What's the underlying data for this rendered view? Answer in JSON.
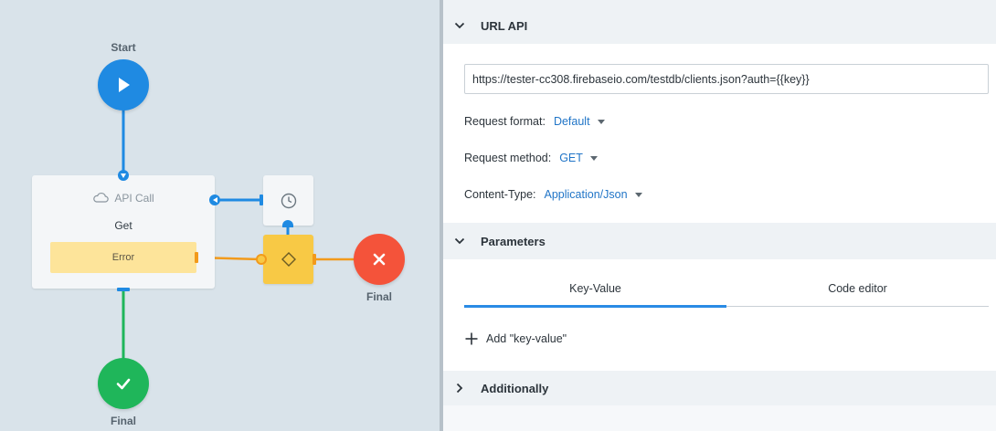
{
  "canvas": {
    "start_label": "Start",
    "final_fail_label": "Final",
    "final_success_label": "Final",
    "api_node": {
      "title": "API Call",
      "method": "Get",
      "error_label": "Error",
      "icon": "cloud-icon"
    },
    "timer_node": {
      "icon": "clock-icon"
    },
    "condition_node": {
      "icon": "diamond-icon"
    },
    "colors": {
      "start": "#1f8ae2",
      "fail": "#f4533a",
      "success": "#1fb65a",
      "link_blue": "#1f8ae2",
      "link_orange": "#f29a1b",
      "link_green": "#1fb65a",
      "condition": "#f8c945",
      "error_box": "#fde49a"
    }
  },
  "panel": {
    "url_section": {
      "title": "URL API",
      "url_value": "https://tester-cc308.firebaseio.com/testdb/clients.json?auth={{key}}",
      "request_format_label": "Request format:",
      "request_format_value": "Default",
      "request_method_label": "Request method:",
      "request_method_value": "GET",
      "content_type_label": "Content-Type:",
      "content_type_value": "Application/Json"
    },
    "parameters_section": {
      "title": "Parameters",
      "tabs": [
        {
          "label": "Key-Value",
          "active": true
        },
        {
          "label": "Code editor",
          "active": false
        }
      ],
      "add_label": "Add \"key-value\""
    },
    "additionally_section": {
      "title": "Additionally"
    },
    "colors": {
      "accent": "#2175c7",
      "tab_active": "#2a8be5"
    }
  }
}
